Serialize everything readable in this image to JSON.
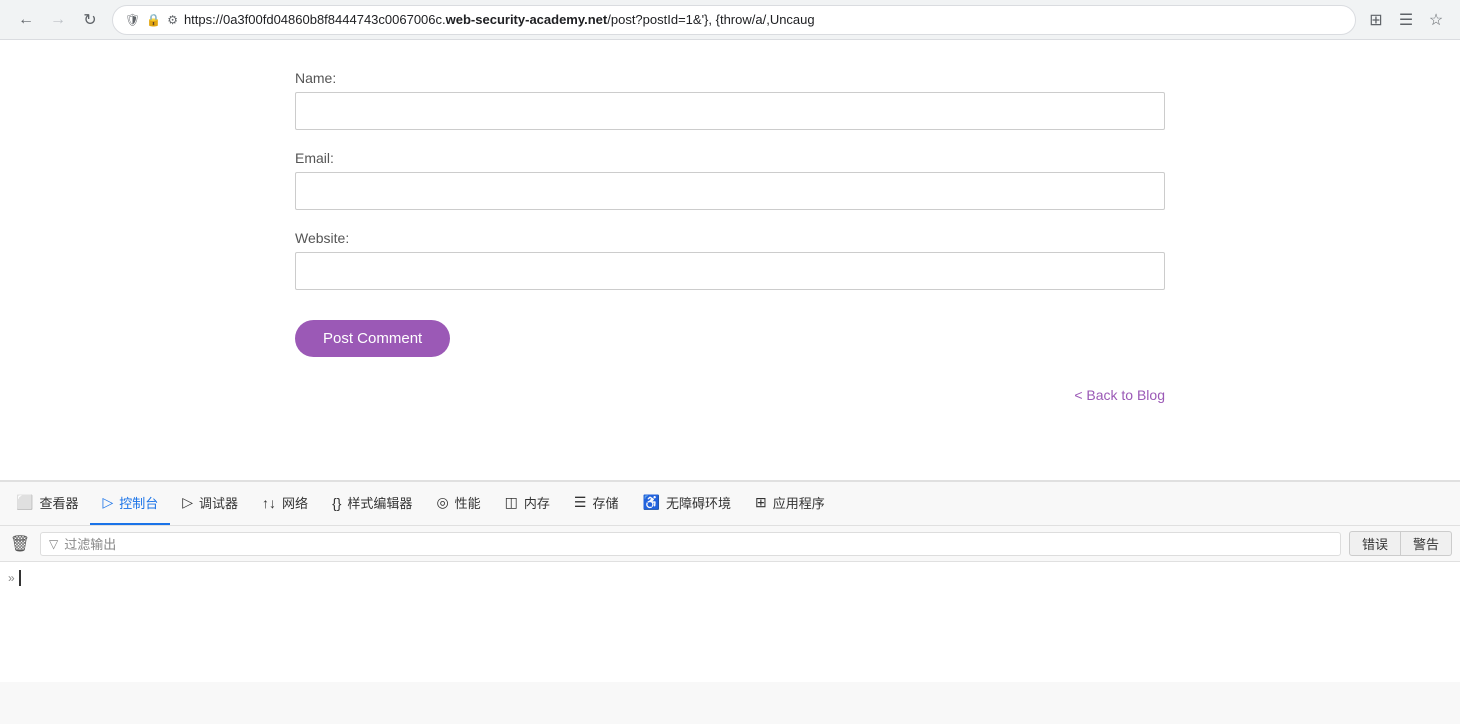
{
  "browser": {
    "back_disabled": false,
    "forward_disabled": true,
    "url_prefix": "https://0a3f00fd04860b8f8444743c0067006c.",
    "url_domain": "web-security-academy.net",
    "url_suffix": "/post?postId=1&'}, {throw/a/,Uncaug",
    "icons": [
      "shield",
      "lock",
      "settings"
    ]
  },
  "form": {
    "name_label": "Name:",
    "email_label": "Email:",
    "website_label": "Website:",
    "name_placeholder": "",
    "email_placeholder": "",
    "website_placeholder": "",
    "submit_button": "Post Comment",
    "back_link": "< Back to Blog"
  },
  "devtools": {
    "tabs": [
      {
        "id": "inspector",
        "label": "查看器",
        "icon": "⬜",
        "active": false
      },
      {
        "id": "console",
        "label": "控制台",
        "icon": "▷",
        "active": true
      },
      {
        "id": "debugger",
        "label": "调试器",
        "icon": "▷",
        "active": false
      },
      {
        "id": "network",
        "label": "网络",
        "icon": "↑↓",
        "active": false
      },
      {
        "id": "style-editor",
        "label": "样式编辑器",
        "icon": "{}",
        "active": false
      },
      {
        "id": "performance",
        "label": "性能",
        "icon": "◎",
        "active": false
      },
      {
        "id": "memory",
        "label": "内存",
        "icon": "◫",
        "active": false
      },
      {
        "id": "storage",
        "label": "存储",
        "icon": "☰",
        "active": false
      },
      {
        "id": "accessibility",
        "label": "无障碍环境",
        "icon": "♿",
        "active": false
      },
      {
        "id": "app",
        "label": "应用程序",
        "icon": "⊞",
        "active": false
      }
    ],
    "filter_placeholder": "过滤输出",
    "error_btn": "错误",
    "warning_btn": "警告",
    "expand_label": "»"
  }
}
